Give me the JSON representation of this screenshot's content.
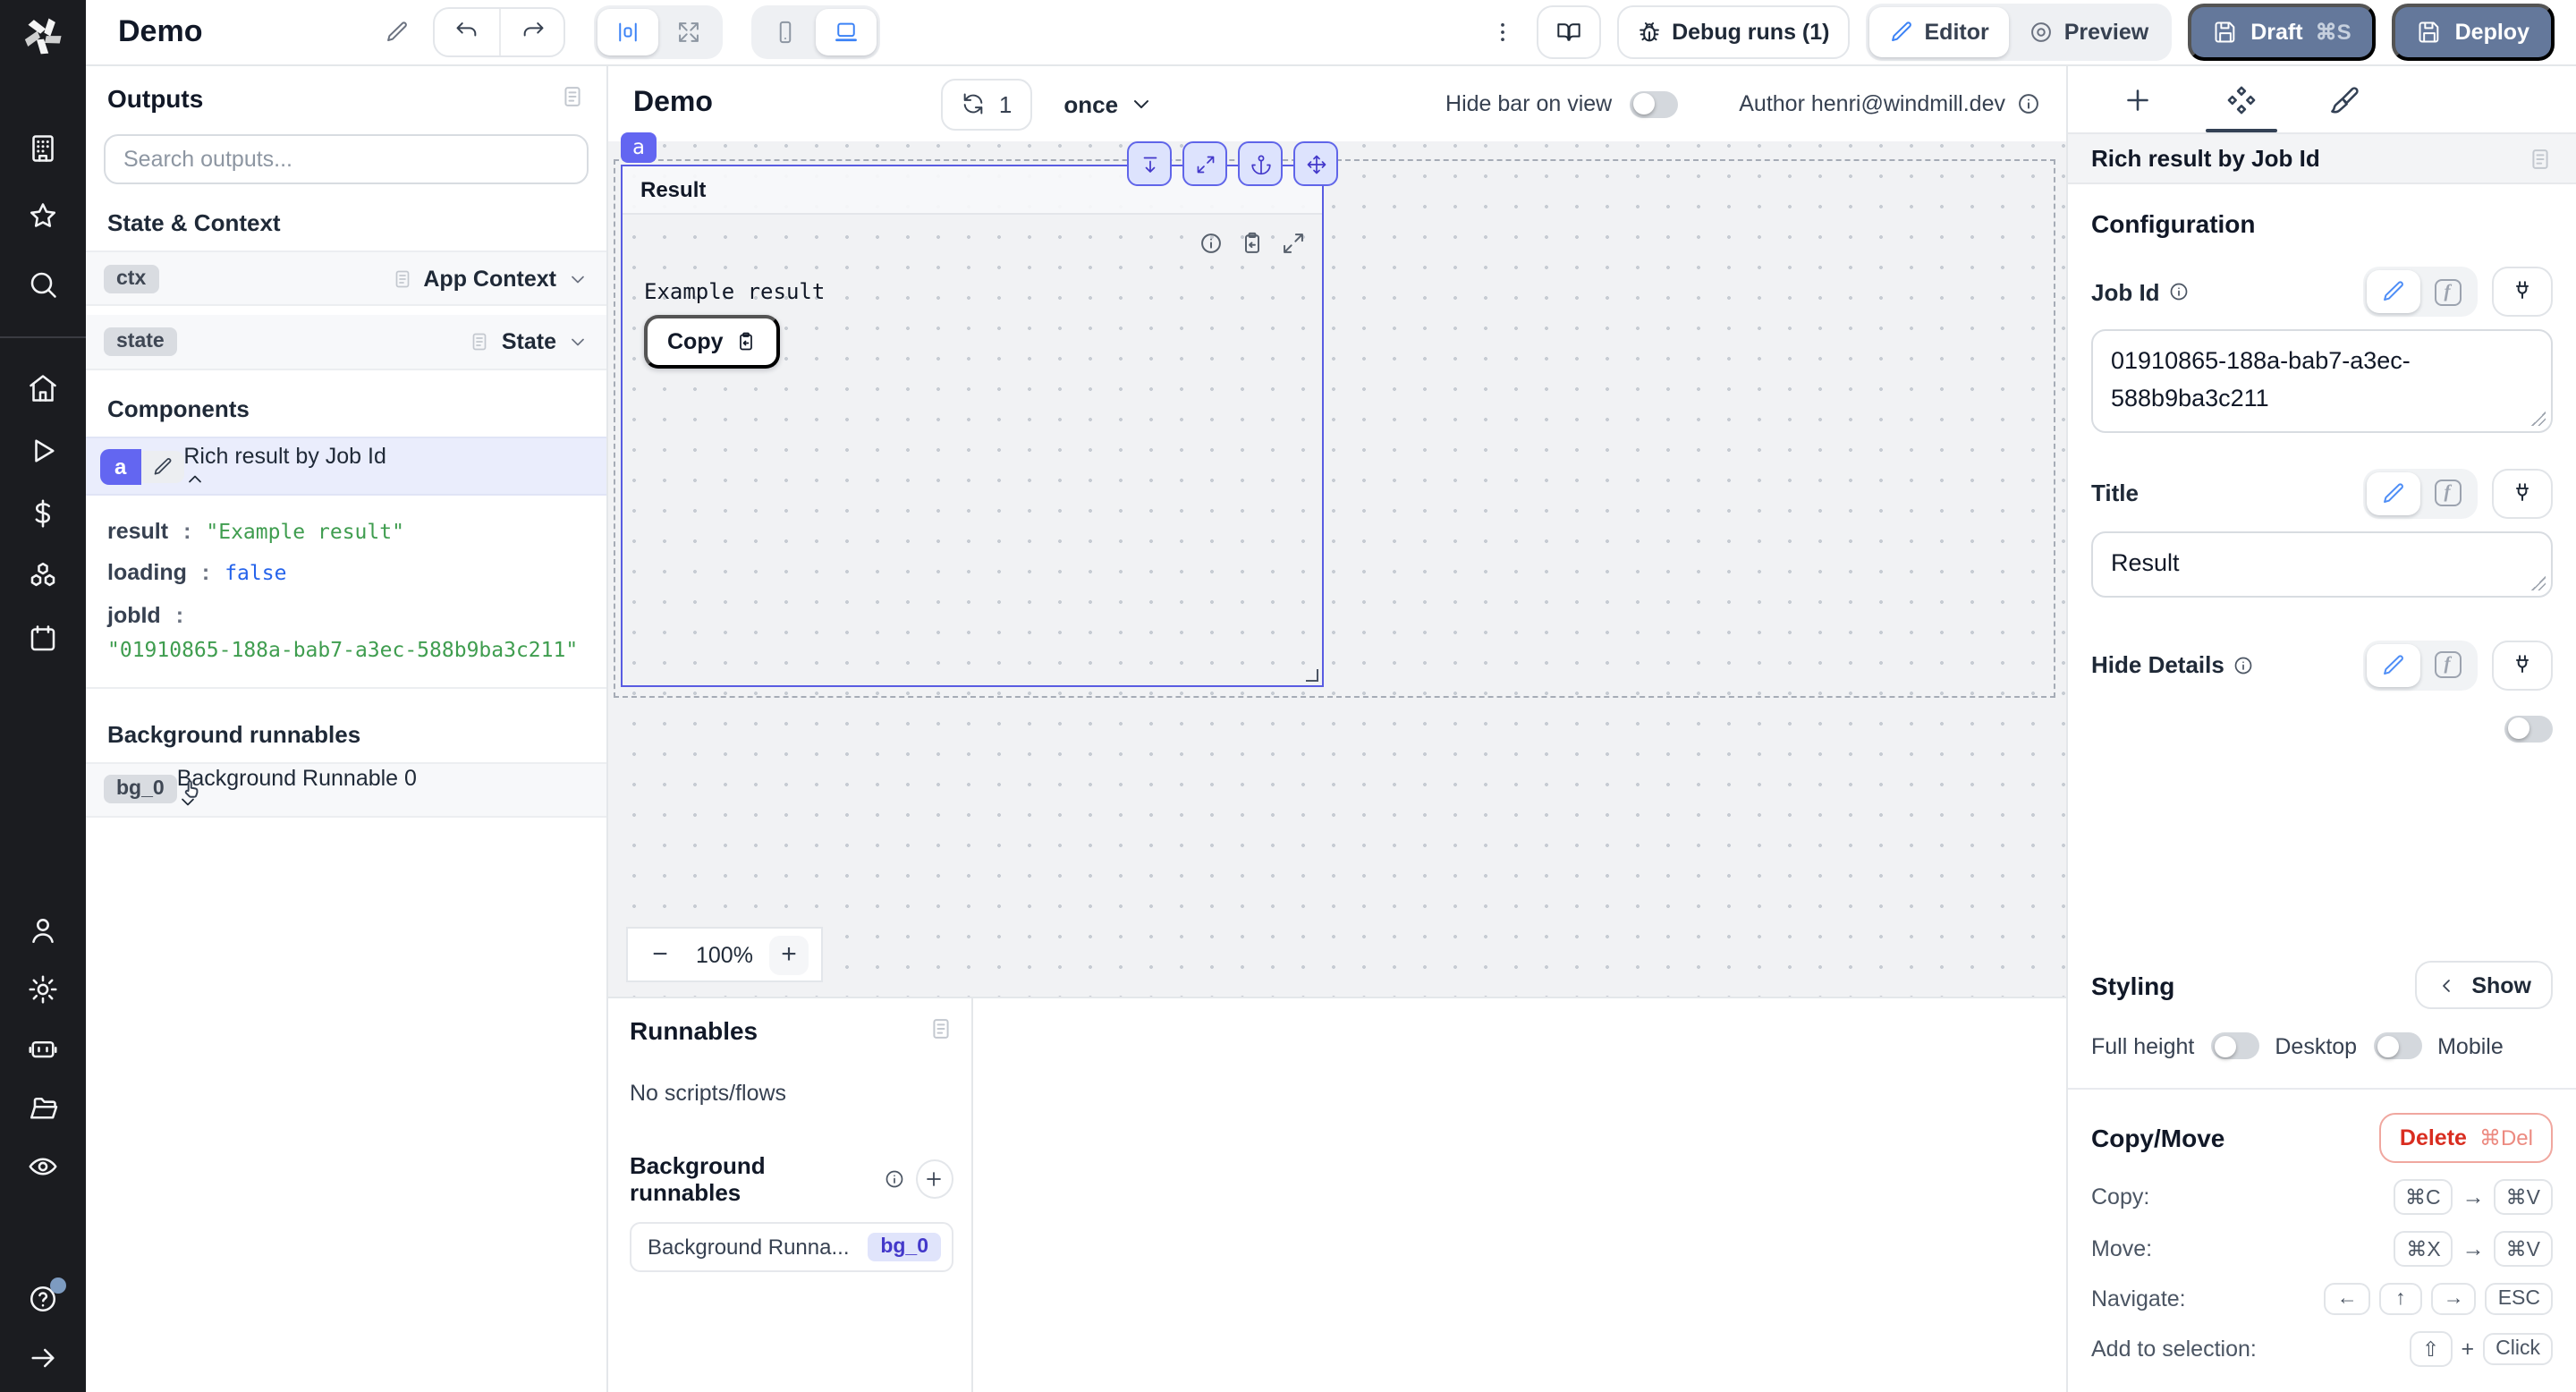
{
  "header": {
    "app_title": "Demo",
    "debug_runs_label": "Debug runs (1)",
    "editor_label": "Editor",
    "preview_label": "Preview",
    "draft_label": "Draft",
    "draft_shortcut": "⌘S",
    "deploy_label": "Deploy"
  },
  "outputs_panel": {
    "title": "Outputs",
    "search_placeholder": "Search outputs...",
    "state_context_title": "State & Context",
    "rows": [
      {
        "badge": "ctx",
        "label": "App Context"
      },
      {
        "badge": "state",
        "label": "State"
      }
    ],
    "components_title": "Components",
    "component": {
      "badge": "a",
      "label": "Rich result by Job Id",
      "fields": [
        {
          "key": "result",
          "value": "\"Example result\""
        },
        {
          "key": "loading",
          "value": "false"
        },
        {
          "key": "jobId",
          "value": "\"01910865-188a-bab7-a3ec-588b9ba3c211\""
        }
      ]
    },
    "background_title": "Background runnables",
    "background_row": {
      "badge": "bg_0",
      "label": "Background Runnable 0"
    }
  },
  "punct": {
    "colon": ":"
  },
  "canvas": {
    "title": "Demo",
    "refresh_count": "1",
    "schedule": "once",
    "hide_bar_label": "Hide bar on view",
    "author_label": "Author henri@windmill.dev",
    "component": {
      "tag": "a",
      "title": "Result",
      "body_text": "Example result",
      "copy_label": "Copy"
    },
    "zoom": {
      "minus": "−",
      "level": "100%",
      "plus": "+"
    }
  },
  "runnables_panel": {
    "title": "Runnables",
    "empty": "No scripts/flows",
    "background_title": "Background runnables",
    "item": {
      "name": "Background Runna...",
      "badge": "bg_0"
    }
  },
  "settings_panel": {
    "component_name": "Rich result by Job Id",
    "configuration_title": "Configuration",
    "job_id_label": "Job Id",
    "job_id_value": "01910865-188a-bab7-a3ec-588b9ba3c211",
    "title_label": "Title",
    "title_value": "Result",
    "hide_details_label": "Hide Details",
    "styling_title": "Styling",
    "show_label": "Show",
    "full_height_label": "Full height",
    "desktop_label": "Desktop",
    "mobile_label": "Mobile",
    "copy_move_title": "Copy/Move",
    "delete_label": "Delete",
    "delete_shortcut": "⌘Del",
    "shortcuts": {
      "copy_label": "Copy:",
      "copy_k1": "⌘C",
      "copy_arrow": "→",
      "copy_k2": "⌘V",
      "move_label": "Move:",
      "move_k1": "⌘X",
      "move_arrow": "→",
      "move_k2": "⌘V",
      "nav_label": "Navigate:",
      "nav_k1": "←",
      "nav_k2": "↑",
      "nav_k3": "→",
      "nav_k4": "ESC",
      "add_label": "Add to selection:",
      "add_k1": "⇧",
      "add_plus": "+",
      "add_k2": "Click"
    }
  },
  "rail_icons": [
    "workspace",
    "favorites",
    "search",
    "home",
    "runs",
    "pricing",
    "resources",
    "schedules",
    "user",
    "settings",
    "workers",
    "folders",
    "audit",
    "help",
    "collapse"
  ],
  "colors": {
    "accent_indigo": "#6366f1",
    "selection_border": "#595ce2",
    "draft_deploy_bg": "#64789b",
    "delete_red": "#d92d20",
    "string_green": "#3f9d4f",
    "bool_blue": "#2563eb",
    "canvas_bg": "#f1f2f4",
    "rail_bg": "#1b1c20"
  }
}
